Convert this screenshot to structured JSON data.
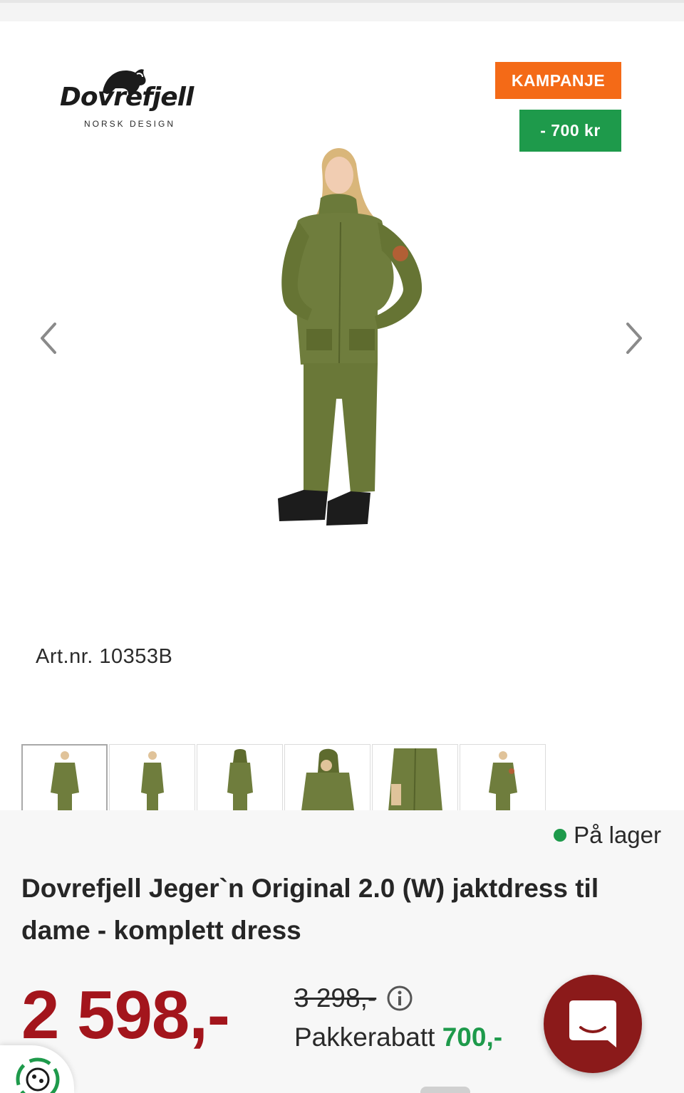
{
  "brand": {
    "name": "Dovrefjell",
    "tagline": "NORSK DESIGN",
    "icon": "muskox-logo-icon"
  },
  "badges": {
    "campaign": "KAMPANJE",
    "discount": "- 700 kr",
    "campaign_color": "#f46a17",
    "discount_color": "#1e9a4b"
  },
  "gallery": {
    "prev_icon": "chevron-left-icon",
    "next_icon": "chevron-right-icon",
    "article_number": "Art.nr. 10353B",
    "thumbnail_count": 6,
    "active_thumbnail": 1
  },
  "product": {
    "stock_status": "På lager",
    "stock_color": "#1e9a4b",
    "title": "Dovrefjell Jeger`n Original 2.0 (W) jaktdress til dame - komplett dress",
    "price": "2 598,-",
    "price_color": "#a3151c",
    "old_price": "3 298,-",
    "package_discount_label": "Pakkerabatt",
    "package_discount_value": "700,-"
  },
  "widgets": {
    "chat_icon": "chat-bubble-icon",
    "chat_color": "#8b1a1a",
    "eco_icon": "recycle-icon"
  }
}
